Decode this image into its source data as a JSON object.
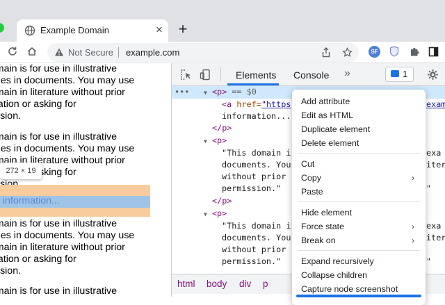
{
  "browser": {
    "tab_title": "Example Domain",
    "tab_close": "×",
    "new_tab": "+",
    "security_label": "Not Secure",
    "url": "example.com",
    "extension_badge": "SF"
  },
  "page": {
    "paragraphs": [
      [
        "domain is for use in illustrative",
        "mples in documents. You may use",
        "domain in literature without prior",
        "dination or asking for",
        "mission."
      ],
      [
        "domain is for use in illustrative",
        "mples in documents. You may use",
        "domain in literature without prior",
        "dination or asking for",
        "mission."
      ],
      [
        "domain is for use in illustrative",
        "mples in documents. You may use",
        "domain in literature without prior",
        "dination or asking for",
        "mission."
      ],
      [
        "domain is for use in illustrative"
      ]
    ],
    "more_info_link": "e information...",
    "dimension_tooltip": "272 × 19"
  },
  "devtools": {
    "tabs": [
      "Elements",
      "Console"
    ],
    "more_tabs": "»",
    "issues_count": "1",
    "breadcrumbs": [
      "html",
      "body",
      "div",
      "p"
    ],
    "dom": {
      "selected_dots": "•••",
      "selected_tag": "<p>",
      "selected_suffix": "== $0",
      "a_open": "<a",
      "a_attr": "href=",
      "a_value": "\"https",
      "a_text": "information...",
      "p_close": "</p>",
      "p_open": "<p>",
      "text_lines": [
        "\"This domain i",
        "documents. You",
        "without prior",
        "permission.\""
      ],
      "right_fragments": [
        "examp",
        "exa",
        "iter",
        "\""
      ]
    }
  },
  "context_menu": {
    "items": [
      {
        "label": "Add attribute",
        "submenu": false
      },
      {
        "label": "Edit as HTML",
        "submenu": false
      },
      {
        "label": "Duplicate element",
        "submenu": false
      },
      {
        "label": "Delete element",
        "submenu": false
      },
      {
        "label": "Cut",
        "submenu": false
      },
      {
        "label": "Copy",
        "submenu": true
      },
      {
        "label": "Paste",
        "submenu": false
      },
      {
        "label": "Hide element",
        "submenu": false
      },
      {
        "label": "Force state",
        "submenu": true
      },
      {
        "label": "Break on",
        "submenu": true
      },
      {
        "label": "Expand recursively",
        "submenu": false
      },
      {
        "label": "Collapse children",
        "submenu": false
      },
      {
        "label": "Capture node screenshot",
        "submenu": false
      }
    ],
    "submenu_arrow": "›"
  },
  "colors": {
    "accent": "#1a73e8",
    "margin_highlight": "#f9cc9d",
    "content_highlight": "#9fc4e7",
    "tag": "#881280"
  }
}
